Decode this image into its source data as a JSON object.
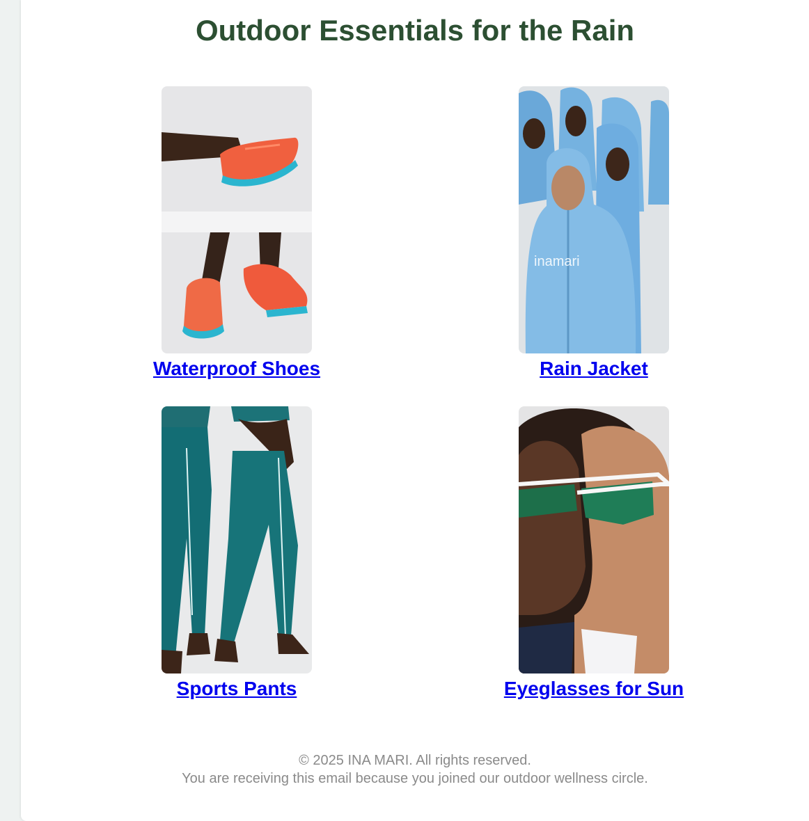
{
  "headline": "Outdoor Essentials for the Rain",
  "products": [
    {
      "label": "Waterproof Shoes",
      "image": "orange running shoes photo"
    },
    {
      "label": "Rain Jacket",
      "image": "blue hooded rain jackets photo",
      "jacket_print": "inamari"
    },
    {
      "label": "Sports Pants",
      "image": "teal sports pants photo"
    },
    {
      "label": "Eyeglasses for Sun",
      "image": "sport sunglasses photo"
    }
  ],
  "footer": {
    "copyright": "© 2025 INA MARI. All rights reserved.",
    "notice": "You are receiving this email because you joined our outdoor wellness circle."
  },
  "colors": {
    "headline": "#2c4f32",
    "link": "#0000ee",
    "footer_text": "#8a8a8a",
    "page_bg": "#eef2f1"
  }
}
